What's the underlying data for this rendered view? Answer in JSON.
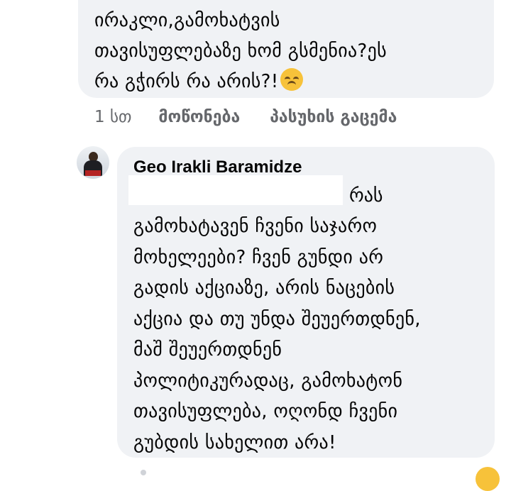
{
  "comment1": {
    "lines": [
      "ირაკლი,გამოხატვის",
      "თავისუფლებაზე ხომ გსმენია?ეს",
      "რა გჭირს რა არის?!"
    ],
    "emoji": "disappointed-face-emoji",
    "time": "1 სთ",
    "like_label": "მოწონება",
    "reply_label": "პასუხის გაცემა"
  },
  "comment2": {
    "author": "Geo Irakli Baramidze",
    "first_word": "რას",
    "lines": [
      "გამოხატავენ ჩვენი საჯარო",
      "მოხელეები? ჩვენ გუნდი არ",
      "გადის აქციაზე, არის ნაცების",
      "აქცია და თუ უნდა შეუერთდნენ,",
      "მაშ შეუერთდნენ",
      "პოლიტიკურადაც, გამოხატონ",
      "თავისუფლება, ოღონდ ჩვენი",
      "გუბდის სახელით არა!"
    ]
  }
}
